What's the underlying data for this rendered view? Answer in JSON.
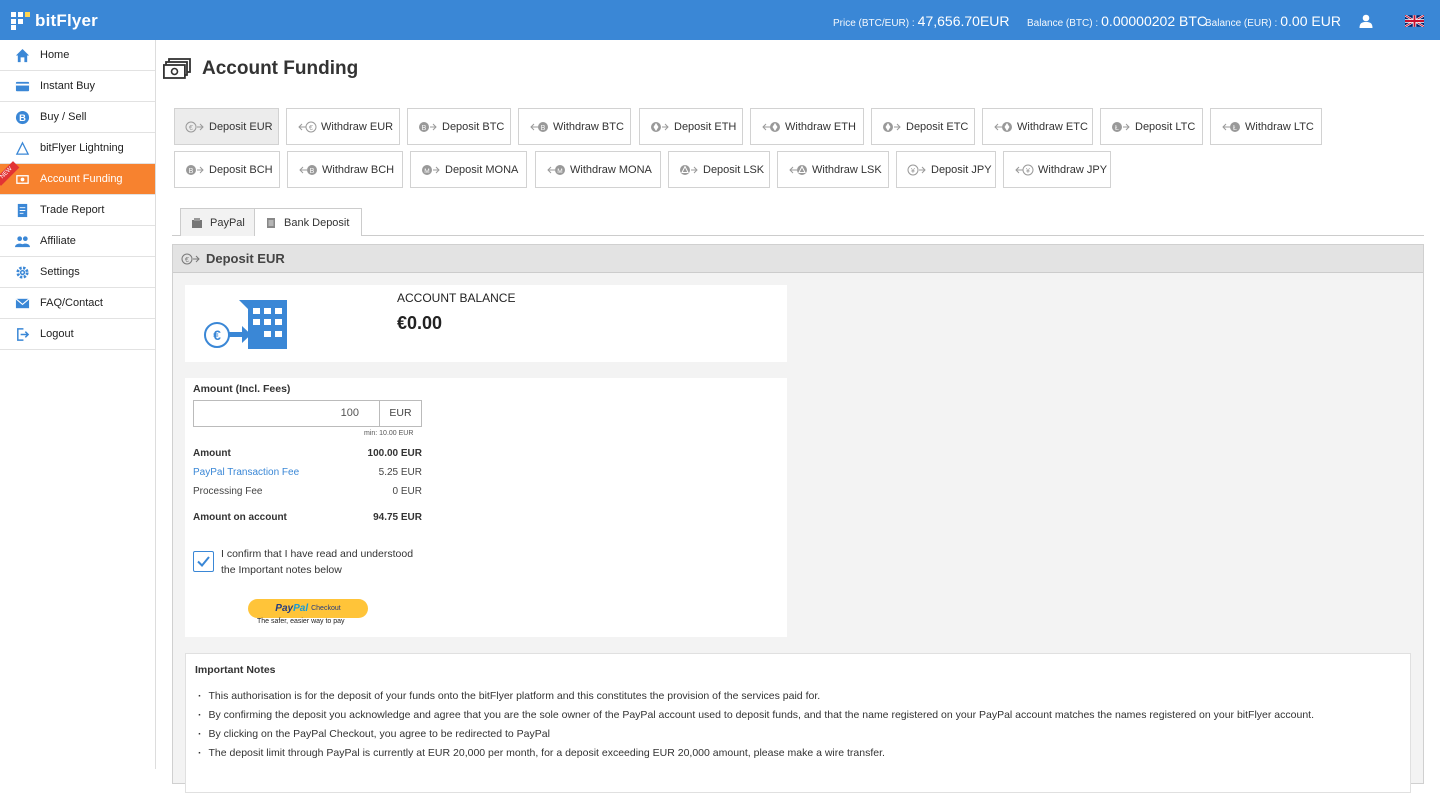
{
  "header": {
    "brand": "bitFlyer",
    "price_label": "Price (BTC/EUR) :",
    "price_value": "47,656.70EUR",
    "btc_balance_label": "Balance (BTC) :",
    "btc_balance_value": "0.00000202 BTC",
    "eur_balance_label": "Balance (EUR) :",
    "eur_balance_value": "0.00 EUR",
    "accent": "#3a87d6"
  },
  "sidebar": {
    "items": [
      {
        "label": "Home",
        "icon": "home-icon"
      },
      {
        "label": "Instant Buy",
        "icon": "card-icon"
      },
      {
        "label": "Buy / Sell",
        "icon": "bitcoin-icon"
      },
      {
        "label": "bitFlyer Lightning",
        "icon": "lightning-icon"
      },
      {
        "label": "Account Funding",
        "icon": "funding-icon",
        "active": true,
        "ribbon": "NEW"
      },
      {
        "label": "Trade Report",
        "icon": "report-icon"
      },
      {
        "label": "Affiliate",
        "icon": "users-icon"
      },
      {
        "label": "Settings",
        "icon": "gear-icon"
      },
      {
        "label": "FAQ/Contact",
        "icon": "mail-icon"
      },
      {
        "label": "Logout",
        "icon": "logout-icon"
      }
    ],
    "active_color": "#f7822f"
  },
  "main": {
    "title": "Account Funding",
    "funding_buttons": [
      "Deposit EUR",
      "Withdraw EUR",
      "Deposit BTC",
      "Withdraw BTC",
      "Deposit ETH",
      "Withdraw ETH",
      "Deposit ETC",
      "Withdraw ETC",
      "Deposit LTC",
      "Withdraw LTC",
      "Deposit BCH",
      "Withdraw BCH",
      "Deposit MONA",
      "Withdraw MONA",
      "Deposit LSK",
      "Withdraw LSK",
      "Deposit JPY",
      "Withdraw JPY"
    ],
    "tabs": [
      "PayPal",
      "Bank Deposit"
    ],
    "panel_title": "Deposit EUR",
    "balance": {
      "label": "ACCOUNT BALANCE",
      "value": "€0.00"
    },
    "form": {
      "amount_label": "Amount (Incl. Fees)",
      "amount_value": "100",
      "currency": "EUR",
      "min_note": "min: 10.00 EUR",
      "rows": [
        {
          "label": "Amount",
          "value": "100.00 EUR"
        },
        {
          "label": "PayPal Transaction Fee",
          "value": "5.25 EUR"
        },
        {
          "label": "Processing Fee",
          "value": "0 EUR"
        },
        {
          "label": "Amount on account",
          "value": "94.75 EUR"
        }
      ],
      "confirm_text": "I confirm that I have read and understood the Important notes below",
      "confirm_checked": true,
      "paypal_logo_a": "Pay",
      "paypal_logo_b": "Pal",
      "paypal_checkout": "Checkout",
      "paypal_tagline": "The safer, easier way to pay"
    },
    "notes": {
      "title": "Important Notes",
      "items": [
        "This authorisation is for the deposit of your funds onto the bitFlyer platform and this constitutes the provision of the services paid for.",
        "By confirming the deposit you acknowledge and agree that you are the sole owner of the PayPal account used to deposit funds, and that the name registered on your PayPal account matches the names registered on your bitFlyer account.",
        "By clicking on the PayPal Checkout, you agree to be redirected to PayPal",
        "The deposit limit through PayPal is currently at EUR 20,000 per month, for a deposit exceeding EUR 20,000 amount, please make a wire transfer."
      ]
    }
  }
}
